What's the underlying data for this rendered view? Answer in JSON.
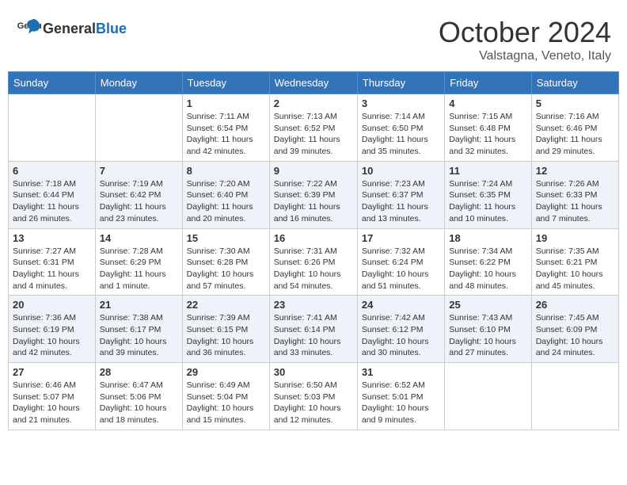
{
  "header": {
    "logo_general": "General",
    "logo_blue": "Blue",
    "month": "October 2024",
    "location": "Valstagna, Veneto, Italy"
  },
  "weekdays": [
    "Sunday",
    "Monday",
    "Tuesday",
    "Wednesday",
    "Thursday",
    "Friday",
    "Saturday"
  ],
  "weeks": [
    [
      {
        "day": "",
        "info": ""
      },
      {
        "day": "",
        "info": ""
      },
      {
        "day": "1",
        "info": "Sunrise: 7:11 AM\nSunset: 6:54 PM\nDaylight: 11 hours and 42 minutes."
      },
      {
        "day": "2",
        "info": "Sunrise: 7:13 AM\nSunset: 6:52 PM\nDaylight: 11 hours and 39 minutes."
      },
      {
        "day": "3",
        "info": "Sunrise: 7:14 AM\nSunset: 6:50 PM\nDaylight: 11 hours and 35 minutes."
      },
      {
        "day": "4",
        "info": "Sunrise: 7:15 AM\nSunset: 6:48 PM\nDaylight: 11 hours and 32 minutes."
      },
      {
        "day": "5",
        "info": "Sunrise: 7:16 AM\nSunset: 6:46 PM\nDaylight: 11 hours and 29 minutes."
      }
    ],
    [
      {
        "day": "6",
        "info": "Sunrise: 7:18 AM\nSunset: 6:44 PM\nDaylight: 11 hours and 26 minutes."
      },
      {
        "day": "7",
        "info": "Sunrise: 7:19 AM\nSunset: 6:42 PM\nDaylight: 11 hours and 23 minutes."
      },
      {
        "day": "8",
        "info": "Sunrise: 7:20 AM\nSunset: 6:40 PM\nDaylight: 11 hours and 20 minutes."
      },
      {
        "day": "9",
        "info": "Sunrise: 7:22 AM\nSunset: 6:39 PM\nDaylight: 11 hours and 16 minutes."
      },
      {
        "day": "10",
        "info": "Sunrise: 7:23 AM\nSunset: 6:37 PM\nDaylight: 11 hours and 13 minutes."
      },
      {
        "day": "11",
        "info": "Sunrise: 7:24 AM\nSunset: 6:35 PM\nDaylight: 11 hours and 10 minutes."
      },
      {
        "day": "12",
        "info": "Sunrise: 7:26 AM\nSunset: 6:33 PM\nDaylight: 11 hours and 7 minutes."
      }
    ],
    [
      {
        "day": "13",
        "info": "Sunrise: 7:27 AM\nSunset: 6:31 PM\nDaylight: 11 hours and 4 minutes."
      },
      {
        "day": "14",
        "info": "Sunrise: 7:28 AM\nSunset: 6:29 PM\nDaylight: 11 hours and 1 minute."
      },
      {
        "day": "15",
        "info": "Sunrise: 7:30 AM\nSunset: 6:28 PM\nDaylight: 10 hours and 57 minutes."
      },
      {
        "day": "16",
        "info": "Sunrise: 7:31 AM\nSunset: 6:26 PM\nDaylight: 10 hours and 54 minutes."
      },
      {
        "day": "17",
        "info": "Sunrise: 7:32 AM\nSunset: 6:24 PM\nDaylight: 10 hours and 51 minutes."
      },
      {
        "day": "18",
        "info": "Sunrise: 7:34 AM\nSunset: 6:22 PM\nDaylight: 10 hours and 48 minutes."
      },
      {
        "day": "19",
        "info": "Sunrise: 7:35 AM\nSunset: 6:21 PM\nDaylight: 10 hours and 45 minutes."
      }
    ],
    [
      {
        "day": "20",
        "info": "Sunrise: 7:36 AM\nSunset: 6:19 PM\nDaylight: 10 hours and 42 minutes."
      },
      {
        "day": "21",
        "info": "Sunrise: 7:38 AM\nSunset: 6:17 PM\nDaylight: 10 hours and 39 minutes."
      },
      {
        "day": "22",
        "info": "Sunrise: 7:39 AM\nSunset: 6:15 PM\nDaylight: 10 hours and 36 minutes."
      },
      {
        "day": "23",
        "info": "Sunrise: 7:41 AM\nSunset: 6:14 PM\nDaylight: 10 hours and 33 minutes."
      },
      {
        "day": "24",
        "info": "Sunrise: 7:42 AM\nSunset: 6:12 PM\nDaylight: 10 hours and 30 minutes."
      },
      {
        "day": "25",
        "info": "Sunrise: 7:43 AM\nSunset: 6:10 PM\nDaylight: 10 hours and 27 minutes."
      },
      {
        "day": "26",
        "info": "Sunrise: 7:45 AM\nSunset: 6:09 PM\nDaylight: 10 hours and 24 minutes."
      }
    ],
    [
      {
        "day": "27",
        "info": "Sunrise: 6:46 AM\nSunset: 5:07 PM\nDaylight: 10 hours and 21 minutes."
      },
      {
        "day": "28",
        "info": "Sunrise: 6:47 AM\nSunset: 5:06 PM\nDaylight: 10 hours and 18 minutes."
      },
      {
        "day": "29",
        "info": "Sunrise: 6:49 AM\nSunset: 5:04 PM\nDaylight: 10 hours and 15 minutes."
      },
      {
        "day": "30",
        "info": "Sunrise: 6:50 AM\nSunset: 5:03 PM\nDaylight: 10 hours and 12 minutes."
      },
      {
        "day": "31",
        "info": "Sunrise: 6:52 AM\nSunset: 5:01 PM\nDaylight: 10 hours and 9 minutes."
      },
      {
        "day": "",
        "info": ""
      },
      {
        "day": "",
        "info": ""
      }
    ]
  ]
}
